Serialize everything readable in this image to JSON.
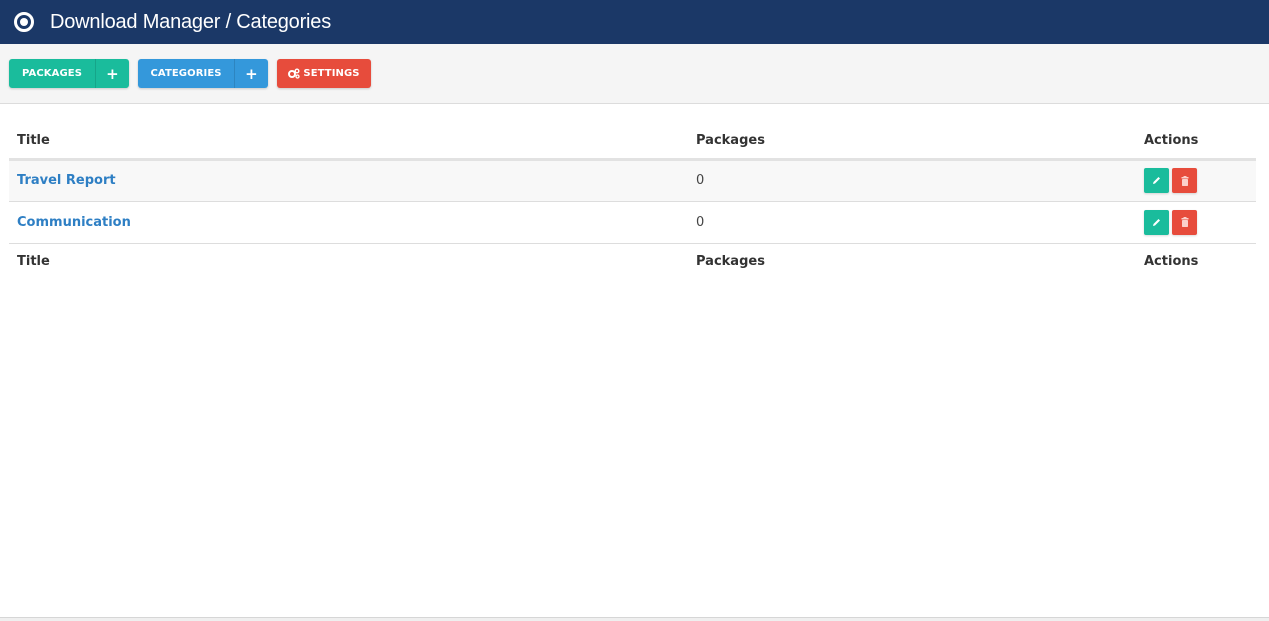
{
  "header": {
    "title": "Download Manager / Categories",
    "logo_icon": "record-circle-icon"
  },
  "toolbar": {
    "packages_label": "PACKAGES",
    "categories_label": "CATEGORIES",
    "add_symbol": "+",
    "settings_label": "SETTINGS",
    "settings_icon": "gears-icon"
  },
  "colors": {
    "header_bg": "#1b3867",
    "teal": "#1abc9c",
    "blue": "#3498db",
    "red": "#e74c3c",
    "link": "#2e7fc4"
  },
  "table": {
    "columns": [
      "Title",
      "Packages",
      "Actions"
    ],
    "rows": [
      {
        "title": "Travel Report",
        "packages": "0"
      },
      {
        "title": "Communication",
        "packages": "0"
      }
    ],
    "row_actions": {
      "edit_icon": "pencil-icon",
      "delete_icon": "trash-icon"
    }
  }
}
